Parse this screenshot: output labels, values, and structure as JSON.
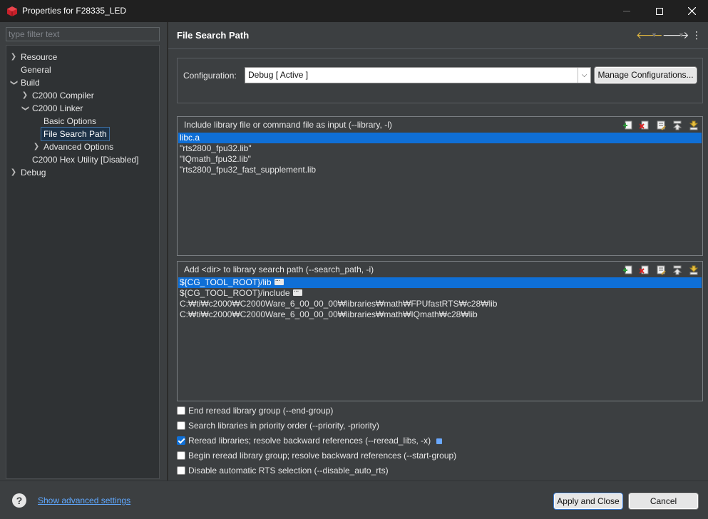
{
  "window": {
    "title": "Properties for F28335_LED",
    "controls": [
      "minimize-icon",
      "maximize-icon",
      "close-icon"
    ]
  },
  "sidebar": {
    "filter_placeholder": "type filter text",
    "items": [
      {
        "label": "Resource",
        "expander": "collapsed"
      },
      {
        "label": "General",
        "expander": "none"
      },
      {
        "label": "Build",
        "expander": "expanded"
      },
      {
        "label": "C2000 Compiler",
        "expander": "collapsed"
      },
      {
        "label": "C2000 Linker",
        "expander": "expanded"
      },
      {
        "label": "Basic Options",
        "expander": "none"
      },
      {
        "label": "File Search Path",
        "expander": "none",
        "selected": true
      },
      {
        "label": "Advanced Options",
        "expander": "collapsed"
      },
      {
        "label": "C2000 Hex Utility  [Disabled]",
        "expander": "none"
      },
      {
        "label": "Debug",
        "expander": "collapsed"
      }
    ]
  },
  "header": {
    "title": "File Search Path",
    "nav_icons": [
      "back-arrow-icon",
      "forward-arrow-icon",
      "view-menu-icon"
    ]
  },
  "configuration": {
    "label": "Configuration:",
    "value": "Debug  [ Active ]",
    "manage_label": "Manage Configurations..."
  },
  "library_group": {
    "title": "Include library file or command file as input (--library, -l)",
    "items": [
      "libc.a",
      "\"rts2800_fpu32.lib\"",
      "\"IQmath_fpu32.lib\"",
      "\"rts2800_fpu32_fast_supplement.lib"
    ],
    "selected_index": 0,
    "tool_icons": [
      "add-icon",
      "delete-icon",
      "edit-icon",
      "move-up-icon",
      "move-down-icon"
    ]
  },
  "search_group": {
    "title": "Add <dir> to library search path (--search_path, -i)",
    "items": [
      "${CG_TOOL_ROOT}/lib",
      "${CG_TOOL_ROOT}/include",
      "C:₩ti₩c2000₩C2000Ware_6_00_00_00₩libraries₩math₩FPUfastRTS₩c28₩lib",
      "C:₩ti₩c2000₩C2000Ware_6_00_00_00₩libraries₩math₩IQmath₩c28₩lib"
    ],
    "selected_index": 0,
    "tool_icons": [
      "add-icon",
      "delete-icon",
      "edit-icon",
      "move-up-icon",
      "move-down-icon"
    ]
  },
  "options": [
    {
      "label": "End reread library group (--end-group)",
      "checked": false
    },
    {
      "label": "Search libraries in priority order (--priority, -priority)",
      "checked": false
    },
    {
      "label": "Reread libraries; resolve backward references (--reread_libs, -x)",
      "checked": true
    },
    {
      "label": "Begin reread library group; resolve backward references (--start-group)",
      "checked": false
    },
    {
      "label": "Disable automatic RTS selection (--disable_auto_rts)",
      "checked": false
    }
  ],
  "footer": {
    "advanced_link": "Show advanced settings",
    "apply_label": "Apply and Close",
    "cancel_label": "Cancel"
  },
  "colors": {
    "selection": "#0f6fd6",
    "panel": "#3c3f41",
    "link": "#5fa8ff"
  }
}
